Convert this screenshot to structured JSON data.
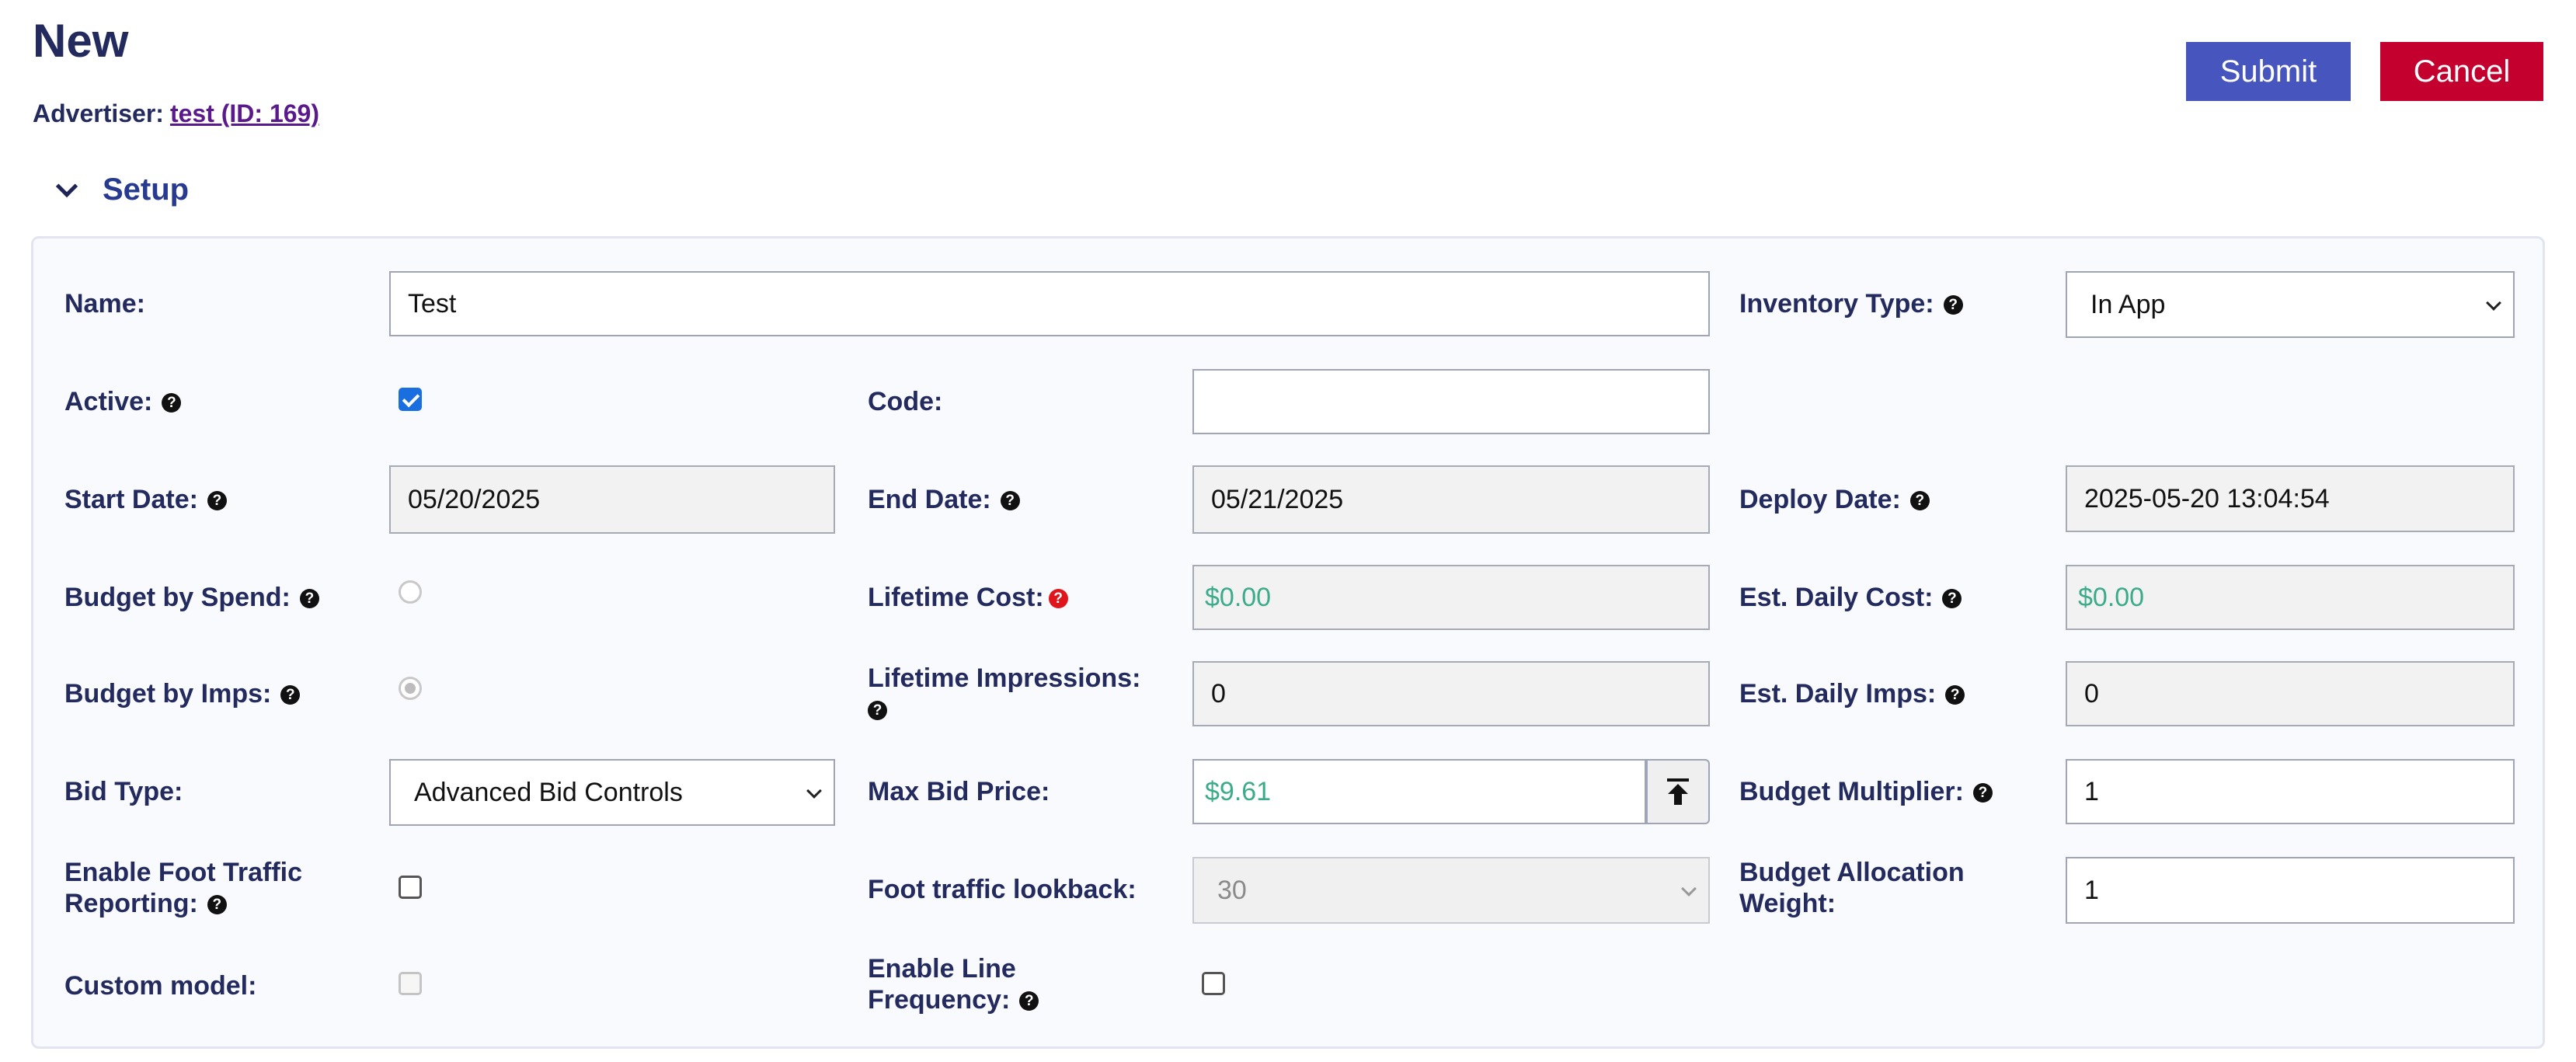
{
  "header": {
    "title": "New",
    "advertiser_label": "Advertiser:",
    "advertiser_link": "test (ID: 169)",
    "submit_label": "Submit",
    "cancel_label": "Cancel"
  },
  "section": {
    "title": "Setup"
  },
  "form": {
    "name": {
      "label": "Name:",
      "value": "Test"
    },
    "inventory_type": {
      "label": "Inventory Type:",
      "value": "In App"
    },
    "active": {
      "label": "Active:",
      "checked": true
    },
    "code": {
      "label": "Code:",
      "value": ""
    },
    "start_date": {
      "label": "Start Date:",
      "value": "05/20/2025"
    },
    "end_date": {
      "label": "End Date:",
      "value": "05/21/2025"
    },
    "deploy_date": {
      "label": "Deploy Date:",
      "value": "2025-05-20 13:04:54"
    },
    "budget_by_spend": {
      "label": "Budget by Spend:",
      "selected": false
    },
    "lifetime_cost": {
      "label": "Lifetime Cost:",
      "value": "$0.00"
    },
    "est_daily_cost": {
      "label": "Est. Daily Cost:",
      "value": "$0.00"
    },
    "budget_by_imps": {
      "label": "Budget by Imps:",
      "selected": true
    },
    "lifetime_impressions": {
      "label": "Lifetime Impressions:",
      "value": "0"
    },
    "est_daily_imps": {
      "label": "Est. Daily Imps:",
      "value": "0"
    },
    "bid_type": {
      "label": "Bid Type:",
      "value": "Advanced Bid Controls"
    },
    "max_bid_price": {
      "label": "Max Bid Price:",
      "value": "$9.61"
    },
    "budget_multiplier": {
      "label": "Budget Multiplier:",
      "value": "1"
    },
    "foot_traffic": {
      "label_line1": "Enable Foot Traffic",
      "label_line2": "Reporting:",
      "checked": false
    },
    "foot_traffic_lookback": {
      "label": "Foot traffic lookback:",
      "value": "30"
    },
    "budget_allocation_weight": {
      "label_line1": "Budget Allocation",
      "label_line2": "Weight:",
      "value": "1"
    },
    "custom_model": {
      "label": "Custom model:",
      "checked": false
    },
    "line_frequency": {
      "label_line1": "Enable Line",
      "label_line2": "Frequency:",
      "checked": false
    }
  },
  "icons": {
    "help_icon_glyph": "?",
    "accent_color": "#4656be",
    "cancel_color": "#c4002f",
    "money_color": "#3bab8a"
  }
}
